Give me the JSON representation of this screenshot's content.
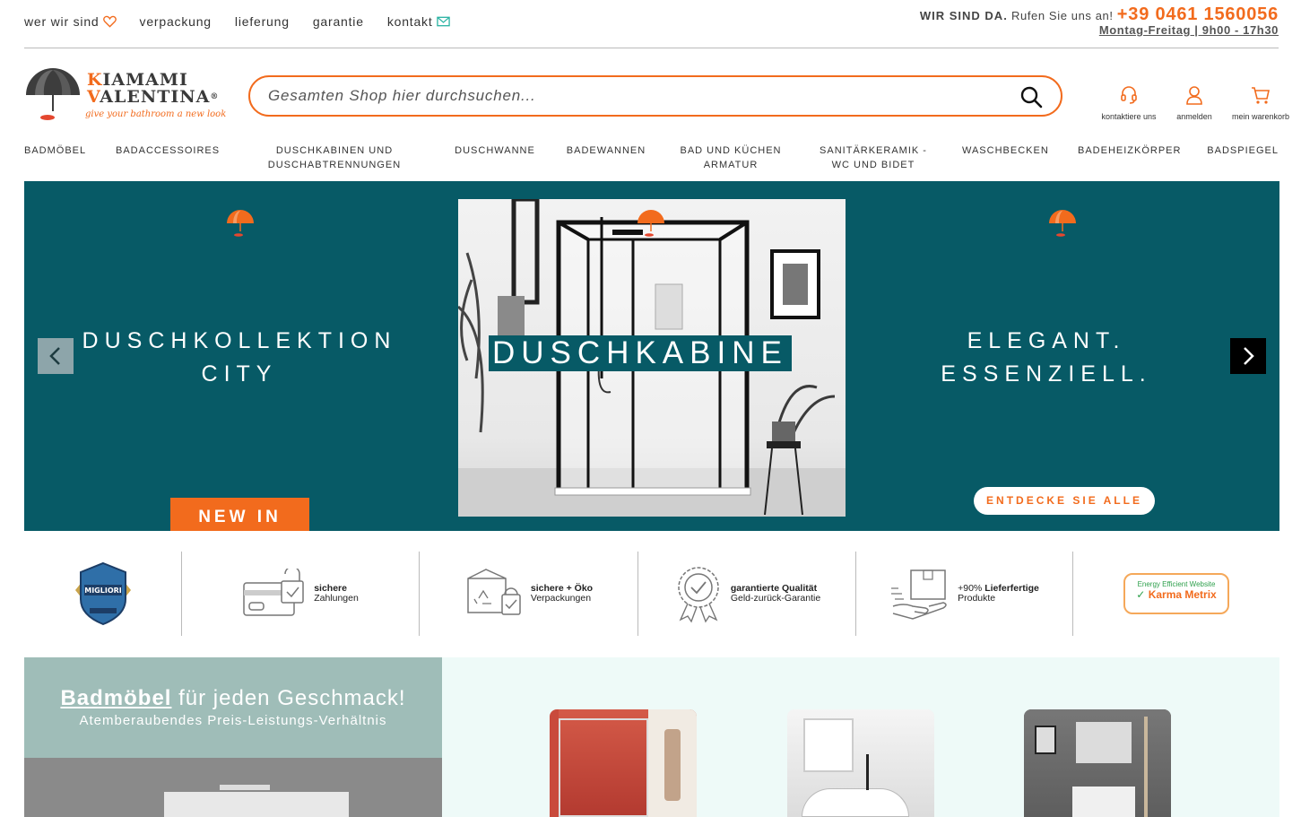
{
  "toplinks": {
    "who": "wer wir sind",
    "packaging": "verpackung",
    "delivery": "lieferung",
    "warranty": "garantie",
    "contact": "kontakt"
  },
  "contact": {
    "label": "WIR SIND DA.",
    "call": "Rufen Sie uns an!",
    "phone": "+39 0461 1560056",
    "hours": "Montag-Freitag | 9h00 - 17h30"
  },
  "logo": {
    "line1_initial": "K",
    "line1_rest": "IAMAMI",
    "line2_initial": "V",
    "line2_rest": "ALENTINA",
    "registered": "®",
    "tagline": "give your bathroom a new look"
  },
  "search": {
    "placeholder": "Gesamten Shop hier durchsuchen..."
  },
  "header_icons": {
    "contact": "kontaktiere uns",
    "login": "anmelden",
    "cart": "mein warenkorb"
  },
  "categories": [
    {
      "label": "BADMÖBEL"
    },
    {
      "label": "BADACCESSOIRES"
    },
    {
      "label": "DUSCHKABINEN UND DUSCHABTRENNUNGEN"
    },
    {
      "label": "DUSCHWANNE"
    },
    {
      "label": "BADEWANNEN"
    },
    {
      "label": "BAD UND KÜCHEN ARMATUR"
    },
    {
      "label": "SANITÄRKERAMIK - WC UND BIDET"
    },
    {
      "label": "WASCHBECKEN"
    },
    {
      "label": "BADEHEIZKÖRPER"
    },
    {
      "label": "BADSPIEGEL"
    }
  ],
  "hero": {
    "left_line1": "DUSCHKOLLEKTION",
    "left_line2": "CITY",
    "center": "DUSCHKABINE",
    "right_line1": "ELEGANT.",
    "right_line2": "ESSENZIELL.",
    "new_in": "NEW IN",
    "cta": "ENTDECKE SIE ALLE"
  },
  "trust": {
    "badge_text": "MIGLIORI",
    "secure_bold": "sichere",
    "secure_rest": "Zahlungen",
    "eco_bold": "sichere + Öko",
    "eco_rest": "Verpackungen",
    "quality_bold": "garantierte Qualität",
    "quality_rest": "Geld-zurück-Garantie",
    "ready_pre": "+90%",
    "ready_bold": "Lieferfertige",
    "ready_rest": "Produkte",
    "karma_top": "Energy Efficient Website",
    "karma_name": "Karma Metrix"
  },
  "promo": {
    "highlight": "Badmöbel",
    "rest": "für jeden Geschmack!",
    "sub": "Atemberaubendes Preis-Leistungs-Verhältnis"
  },
  "colors": {
    "accent": "#f26b1d",
    "hero_bg": "#075a66",
    "promo_bg": "#9fbdb8",
    "section_bg": "#eefaf8"
  }
}
